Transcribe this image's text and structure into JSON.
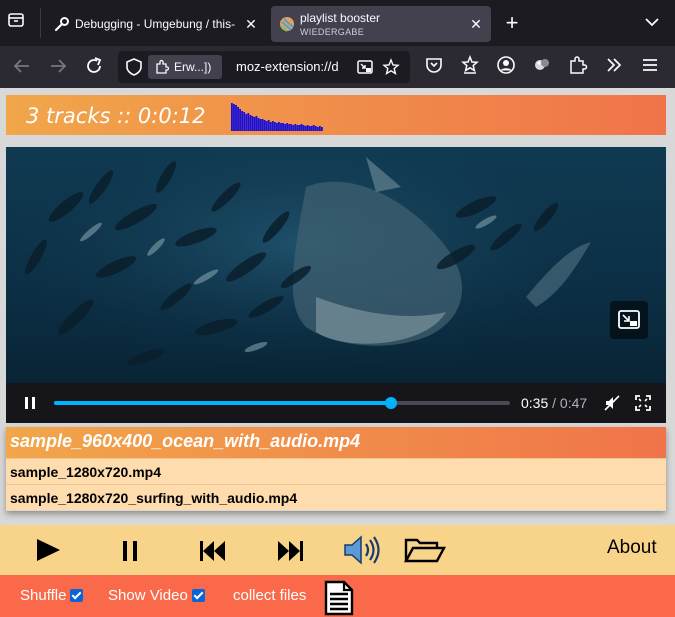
{
  "browser": {
    "tabs": [
      {
        "title": "Debugging - Umgebung / this-"
      },
      {
        "title": "playlist booster",
        "subtitle": "WIEDERGABE"
      }
    ],
    "identity_label": "Erw...])",
    "url": "moz-extension://d"
  },
  "app": {
    "header_title": "3 tracks :: 0:0:12",
    "visualizer_bars": [
      28,
      27,
      26,
      24,
      22,
      20,
      19,
      17,
      18,
      16,
      15,
      14,
      15,
      13,
      12,
      12,
      11,
      10,
      11,
      9,
      10,
      9,
      8,
      9,
      8,
      8,
      7,
      8,
      7,
      7,
      6,
      7,
      6,
      6,
      7,
      6,
      5,
      6,
      5,
      5,
      6,
      5,
      4,
      5,
      4
    ],
    "visualizer_color": "#1a0fd8",
    "video": {
      "current_time": "0:35",
      "duration": "/ 0:47",
      "progress": 0.74,
      "accent_color": "#00b3ff"
    },
    "playlist": {
      "current": "sample_960x400_ocean_with_audio.mp4",
      "items": [
        "sample_1280x720.mp4",
        "sample_1280x720_surfing_with_audio.mp4"
      ]
    },
    "player_controls": {
      "about_label": "About"
    },
    "options": {
      "shuffle_label": "Shuffle",
      "shuffle_checked": true,
      "show_video_label": "Show Video",
      "show_video_checked": true,
      "collect_label": "collect files"
    }
  }
}
